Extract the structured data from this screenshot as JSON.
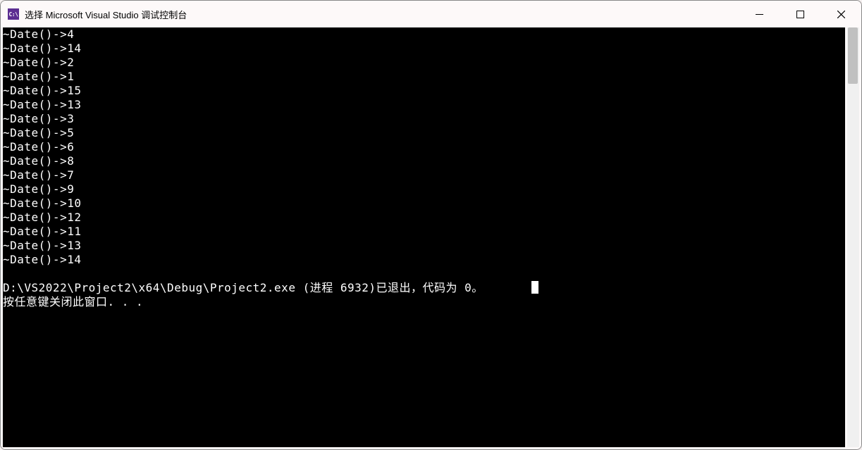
{
  "titlebar": {
    "icon_label": "C:\\",
    "title": "选择 Microsoft Visual Studio 调试控制台"
  },
  "console": {
    "lines": [
      "~Date()->4",
      "~Date()->14",
      "~Date()->2",
      "~Date()->1",
      "~Date()->15",
      "~Date()->13",
      "~Date()->3",
      "~Date()->5",
      "~Date()->6",
      "~Date()->8",
      "~Date()->7",
      "~Date()->9",
      "~Date()->10",
      "~Date()->12",
      "~Date()->11",
      "~Date()->13",
      "~Date()->14",
      "",
      "D:\\VS2022\\Project2\\x64\\Debug\\Project2.exe (进程 6932)已退出，代码为 0。",
      "按任意键关闭此窗口. . ."
    ]
  }
}
